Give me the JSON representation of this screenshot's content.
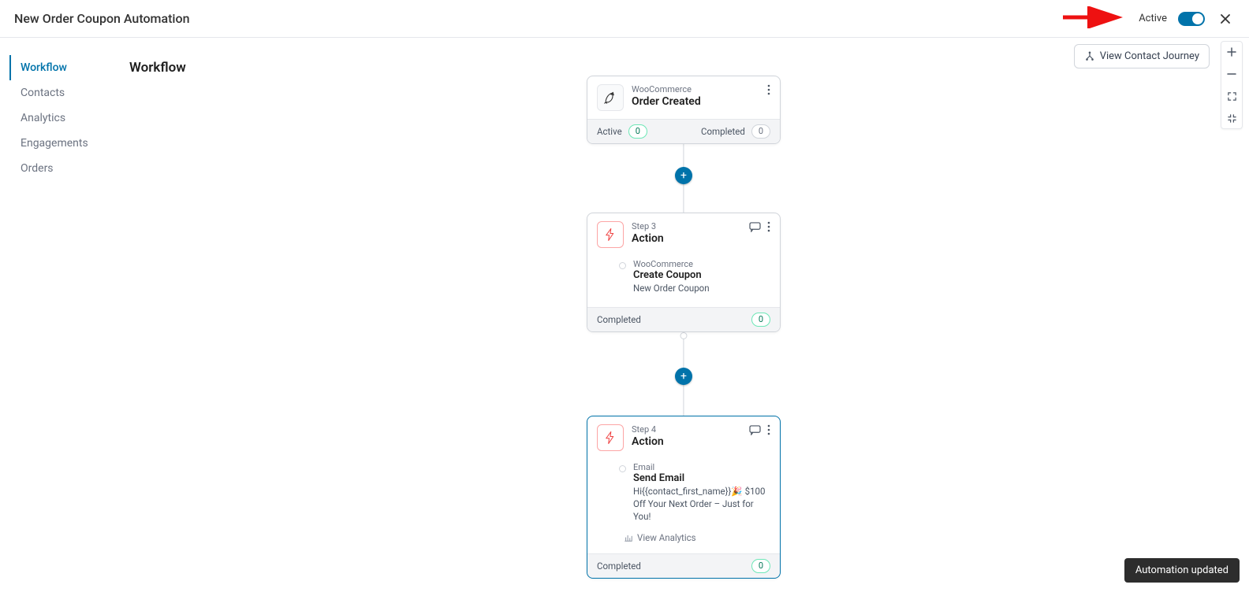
{
  "header": {
    "title": "New Order Coupon Automation",
    "active_label": "Active"
  },
  "sidebar": {
    "items": [
      {
        "label": "Workflow"
      },
      {
        "label": "Contacts"
      },
      {
        "label": "Analytics"
      },
      {
        "label": "Engagements"
      },
      {
        "label": "Orders"
      }
    ]
  },
  "section": {
    "title": "Workflow"
  },
  "controls": {
    "view_journey": "View Contact Journey"
  },
  "nodes": {
    "trigger": {
      "eyebrow": "WooCommerce",
      "title": "Order Created",
      "active_label": "Active",
      "active_count": "0",
      "completed_label": "Completed",
      "completed_count": "0"
    },
    "step3": {
      "eyebrow": "Step 3",
      "title": "Action",
      "service": "WooCommerce",
      "action": "Create Coupon",
      "desc": "New Order Coupon",
      "completed_label": "Completed",
      "completed_count": "0"
    },
    "step4": {
      "eyebrow": "Step 4",
      "title": "Action",
      "service": "Email",
      "action": "Send Email",
      "desc": "Hi{{contact_first_name}}🎉 $100 Off Your Next Order – Just for You!",
      "analytics": "View Analytics",
      "completed_label": "Completed",
      "completed_count": "0"
    }
  },
  "toast": {
    "msg": "Automation updated"
  }
}
